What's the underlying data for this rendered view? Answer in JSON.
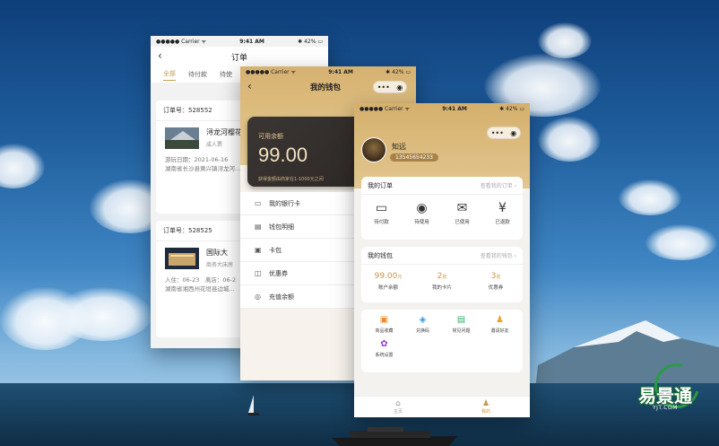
{
  "status": {
    "carrier": "●●●●● Carrier ᯤ",
    "time": "9:41 AM",
    "battery": "✱ 42% ▭"
  },
  "orders_screen": {
    "title": "订单",
    "tabs": [
      "全部",
      "待付款",
      "待使"
    ],
    "orders": [
      {
        "order_no": "订单号：528552",
        "name": "浔龙河樱花",
        "sub": "成人票",
        "meta1": "游玩日期：2021-06-16",
        "meta2": "湖南省长沙县黄兴镇浔龙河..."
      },
      {
        "order_no": "订单号：528525",
        "name": "国际大",
        "sub": "商务大床房",
        "meta1": "入住：06-23　离店：06-2",
        "meta2": "湖南省湘西州花垣县边城..."
      }
    ]
  },
  "wallet_screen": {
    "title": "我的钱包",
    "balance_label": "可用余额",
    "balance": "99.00",
    "balance_tip": "获得金额由商家在1-1000元之间",
    "rows": [
      {
        "icon": "▭",
        "label": "我的银行卡"
      },
      {
        "icon": "▤",
        "label": "钱包明细"
      },
      {
        "icon": "▣",
        "label": "卡包"
      },
      {
        "icon": "◫",
        "label": "优惠券"
      },
      {
        "icon": "◎",
        "label": "充值余额"
      }
    ]
  },
  "me_screen": {
    "username": "知远",
    "phone": "13545654233",
    "orders_section": {
      "title": "我的订单",
      "more": "查看我的订单 ›",
      "items": [
        {
          "icon": "▭",
          "label": "待付款"
        },
        {
          "icon": "◉",
          "label": "待使用"
        },
        {
          "icon": "✉",
          "label": "已使用"
        },
        {
          "icon": "¥",
          "label": "已退款"
        }
      ]
    },
    "wallet_section": {
      "title": "我的钱包",
      "more": "查看我的钱包 ›",
      "stats": [
        {
          "value": "99.00",
          "unit": "元",
          "label": "账户余额"
        },
        {
          "value": "2",
          "unit": "张",
          "label": "我的卡片"
        },
        {
          "value": "3",
          "unit": "张",
          "label": "优惠券"
        }
      ]
    },
    "tools": [
      {
        "icon": "▣",
        "color": "#f08a2c",
        "label": "商品收藏"
      },
      {
        "icon": "◈",
        "color": "#2fa0e8",
        "label": "兑换码"
      },
      {
        "icon": "▤",
        "color": "#2fb36b",
        "label": "常见问题"
      },
      {
        "icon": "♟",
        "color": "#f0a020",
        "label": "邀请好友"
      },
      {
        "icon": "✿",
        "color": "#8a3fd1",
        "label": "系统设置"
      }
    ],
    "tabbar": [
      {
        "icon": "⌂",
        "label": "主页"
      },
      {
        "icon": "♟",
        "label": "我的"
      }
    ]
  },
  "watermark": {
    "text": "易景通",
    "url": "YJT.COM"
  }
}
